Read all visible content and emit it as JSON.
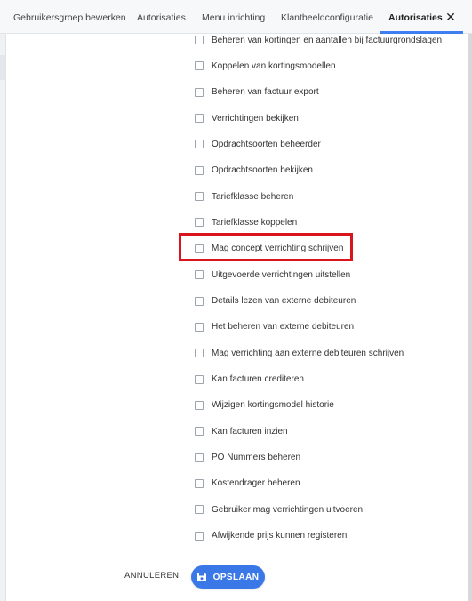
{
  "tabs": [
    {
      "label": "Gebruikersgroep bewerken"
    },
    {
      "label": "Autorisaties"
    },
    {
      "label": "Menu inrichting"
    },
    {
      "label": "Klantbeeldconfiguratie"
    },
    {
      "label": "Autorisaties",
      "active": true
    }
  ],
  "close_icon": "close-icon",
  "permissions": [
    {
      "label": "Beheren van kortingen en aantallen bij factuurgrondslagen",
      "checked": false
    },
    {
      "label": "Koppelen van kortingsmodellen",
      "checked": false
    },
    {
      "label": "Beheren van factuur export",
      "checked": false
    },
    {
      "label": "Verrichtingen bekijken",
      "checked": false
    },
    {
      "label": "Opdrachtsoorten beheerder",
      "checked": false
    },
    {
      "label": "Opdrachtsoorten bekijken",
      "checked": false
    },
    {
      "label": "Tariefklasse beheren",
      "checked": false
    },
    {
      "label": "Tariefklasse koppelen",
      "checked": false
    },
    {
      "label": "Mag concept verrichting schrijven",
      "checked": false,
      "highlighted": true
    },
    {
      "label": "Uitgevoerde verrichtingen uitstellen",
      "checked": false
    },
    {
      "label": "Details lezen van externe debiteuren",
      "checked": false
    },
    {
      "label": "Het beheren van externe debiteuren",
      "checked": false
    },
    {
      "label": "Mag verrichting aan externe debiteuren schrijven",
      "checked": false
    },
    {
      "label": "Kan facturen crediteren",
      "checked": false
    },
    {
      "label": "Wijzigen kortingsmodel historie",
      "checked": false
    },
    {
      "label": "Kan facturen inzien",
      "checked": false
    },
    {
      "label": "PO Nummers beheren",
      "checked": false
    },
    {
      "label": "Kostendrager beheren",
      "checked": false
    },
    {
      "label": "Gebruiker mag verrichtingen uitvoeren",
      "checked": false
    },
    {
      "label": "Afwijkende prijs kunnen registeren",
      "checked": false
    }
  ],
  "actions": {
    "cancel_label": "ANNULEREN",
    "save_label": "OPSLAAN",
    "save_icon": "floppy-disk-icon"
  },
  "colors": {
    "accent": "#3b78e7",
    "highlight_border": "#d9141d",
    "tab_bar_bg": "#f7f8f9"
  }
}
